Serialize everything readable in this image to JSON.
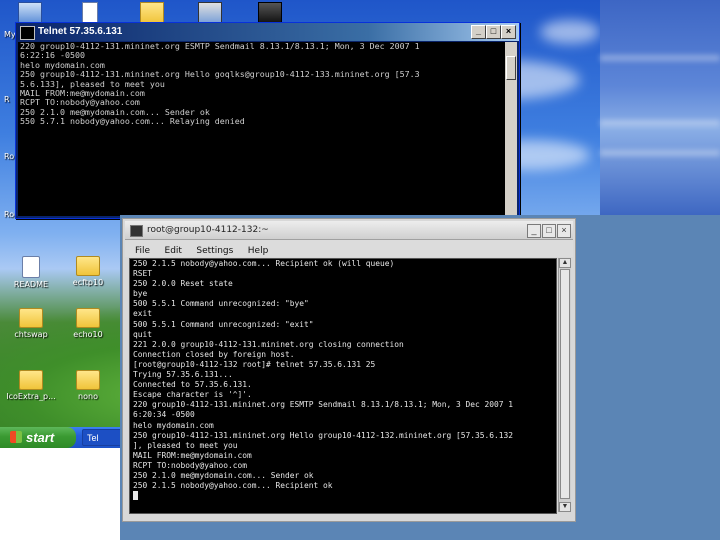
{
  "xp_desktop": {
    "top_icons": [
      "my-computer-icon",
      "document-icon",
      "folder-icon",
      "network-icon",
      "program-icon"
    ],
    "icons": [
      {
        "label": "README",
        "kind": "doc"
      },
      {
        "label": "ecftp10",
        "kind": "folder"
      },
      {
        "label": "chtswap",
        "kind": "folder"
      },
      {
        "label": "echo10",
        "kind": "folder"
      },
      {
        "label": "IcoExtra_p...",
        "kind": "folder"
      },
      {
        "label": "nono",
        "kind": "folder"
      }
    ],
    "edge_labels": [
      "My",
      "R",
      "Ro",
      "Roc"
    ],
    "taskbar": {
      "start_label": "start",
      "task_label": "Tel"
    },
    "telnet_window": {
      "title": "Telnet 57.35.6.131",
      "lines": [
        "220 group10-4112-131.mininet.org ESMTP Sendmail 8.13.1/8.13.1; Mon, 3 Dec 2007 1",
        "6:22:16 -0500",
        "helo mydomain.com",
        "250 group10-4112-131.mininet.org Hello goqlks@group10-4112-133.mininet.org [57.3",
        "5.6.133], pleased to meet you",
        "MAIL FROM:me@mydomain.com",
        "RCPT TO:nobody@yahoo.com",
        "250 2.1.0 me@mydomain.com... Sender ok",
        "550 5.7.1 nobody@yahoo.com... Relaying denied"
      ]
    }
  },
  "linux_terminal": {
    "title": "root@group10-4112-132:~",
    "menu": [
      "File",
      "Edit",
      "Settings",
      "Help"
    ],
    "lines": [
      "250 2.1.5 nobody@yahoo.com... Recipient ok (will queue)",
      "RSET",
      "250 2.0.0 Reset state",
      "bye",
      "500 5.5.1 Command unrecognized: \"bye\"",
      "exit",
      "500 5.5.1 Command unrecognized: \"exit\"",
      "quit",
      "221 2.0.0 group10-4112-131.mininet.org closing connection",
      "Connection closed by foreign host.",
      "[root@group10-4112-132 root]# telnet 57.35.6.131 25",
      "Trying 57.35.6.131...",
      "Connected to 57.35.6.131.",
      "Escape character is '^]'.",
      "220 group10-4112-131.mininet.org ESMTP Sendmail 8.13.1/8.13.1; Mon, 3 Dec 2007 1",
      "6:20:34 -0500",
      "helo mydomain.com",
      "250 group10-4112-131.mininet.org Hello group10-4112-132.mininet.org [57.35.6.132",
      "], pleased to meet you",
      "MAIL FROM:me@mydomain.com",
      "RCPT TO:nobody@yahoo.com",
      "250 2.1.0 me@mydomain.com... Sender ok",
      "250 2.1.5 nobody@yahoo.com... Recipient ok"
    ]
  },
  "colors": {
    "console_bg": "#000000",
    "console_text": "#e6e6e6",
    "panel_blue": "#5b85b5",
    "xp_title": "#0a246a"
  }
}
